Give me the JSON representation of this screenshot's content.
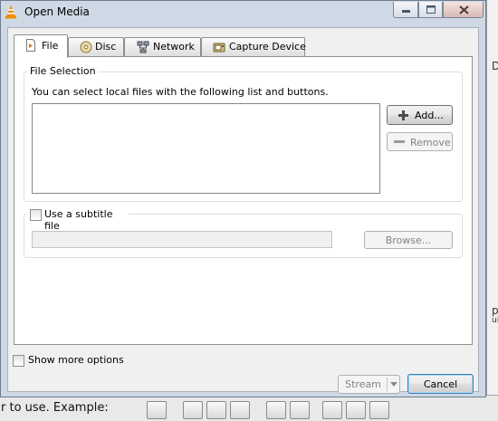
{
  "background": {
    "bottom_text": "r to use. Example: ",
    "right_glyphs": [
      "D",
      "p",
      "ui"
    ]
  },
  "window": {
    "title": "Open Media"
  },
  "tabs": [
    {
      "label": "File",
      "icon": "file-icon",
      "active": true
    },
    {
      "label": "Disc",
      "icon": "disc-icon",
      "active": false
    },
    {
      "label": "Network",
      "icon": "network-icon",
      "active": false
    },
    {
      "label": "Capture Device",
      "icon": "capture-device-icon",
      "active": false
    }
  ],
  "file_selection": {
    "group_title": "File Selection",
    "description": "You can select local files with the following list and buttons.",
    "add_label": "Add...",
    "remove_label": "Remove"
  },
  "subtitle": {
    "checkbox_label": "Use a subtitle file",
    "checked": false,
    "path_value": "",
    "browse_label": "Browse..."
  },
  "footer": {
    "show_more_label": "Show more options",
    "show_more_checked": false,
    "stream_label": "Stream",
    "cancel_label": "Cancel"
  }
}
